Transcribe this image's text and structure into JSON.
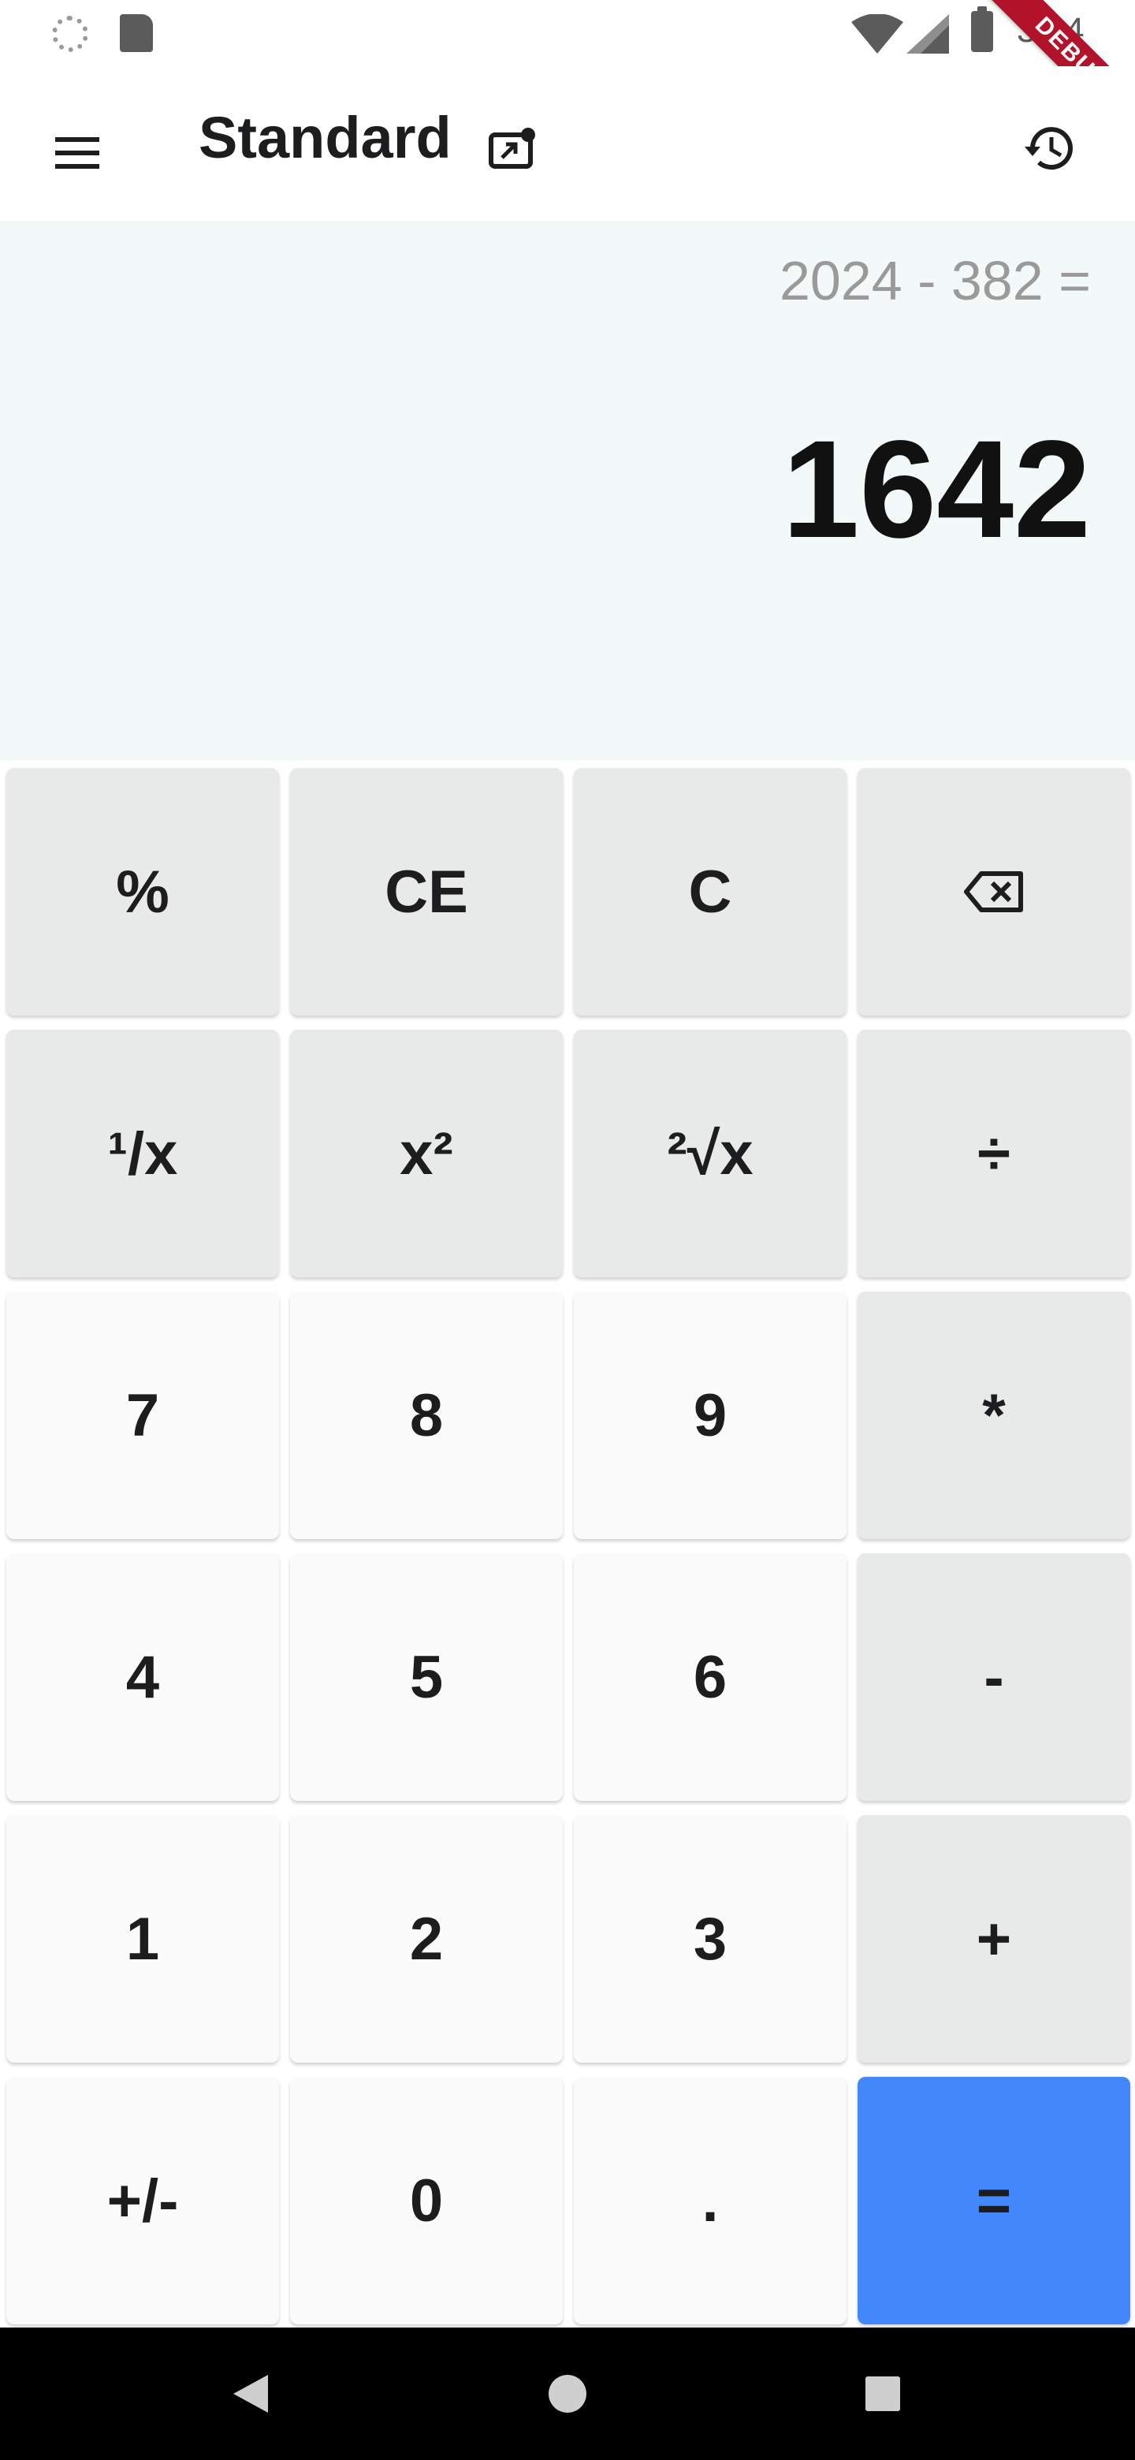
{
  "status_bar": {
    "time": "3:14",
    "icons": [
      "sync-icon",
      "sd-card-icon",
      "wifi-icon",
      "signal-icon",
      "battery-icon"
    ]
  },
  "debug_banner": "DEBUG",
  "app_bar": {
    "title": "Standard",
    "icons": {
      "menu": "menu-icon",
      "mode": "picture-in-picture-icon",
      "history": "history-icon"
    }
  },
  "display": {
    "expression": "2024 - 382 =",
    "result": "1642"
  },
  "keypad": {
    "rows": [
      [
        {
          "label": "%",
          "kind": "func"
        },
        {
          "label": "CE",
          "kind": "func"
        },
        {
          "label": "C",
          "kind": "func"
        },
        {
          "label": "",
          "kind": "func",
          "icon": "backspace-icon"
        }
      ],
      [
        {
          "label": "¹/x",
          "kind": "func"
        },
        {
          "label": "x²",
          "kind": "func"
        },
        {
          "label": "²√x",
          "kind": "func"
        },
        {
          "label": "÷",
          "kind": "op"
        }
      ],
      [
        {
          "label": "7",
          "kind": "num"
        },
        {
          "label": "8",
          "kind": "num"
        },
        {
          "label": "9",
          "kind": "num"
        },
        {
          "label": "*",
          "kind": "op"
        }
      ],
      [
        {
          "label": "4",
          "kind": "num"
        },
        {
          "label": "5",
          "kind": "num"
        },
        {
          "label": "6",
          "kind": "num"
        },
        {
          "label": "-",
          "kind": "op"
        }
      ],
      [
        {
          "label": "1",
          "kind": "num"
        },
        {
          "label": "2",
          "kind": "num"
        },
        {
          "label": "3",
          "kind": "num"
        },
        {
          "label": "+",
          "kind": "op"
        }
      ],
      [
        {
          "label": "+/-",
          "kind": "num"
        },
        {
          "label": "0",
          "kind": "num"
        },
        {
          "label": ".",
          "kind": "num"
        },
        {
          "label": "=",
          "kind": "eq"
        }
      ]
    ]
  },
  "colors": {
    "display_background": "#f3f8f8",
    "function_key": "#e8eaea",
    "number_key": "#fbfbfb",
    "equals_key": "#4388fb",
    "expression_text": "#9a9a9a",
    "debug_ribbon": "#b2132b"
  },
  "nav_bar": {
    "icons": [
      "back-icon",
      "home-icon",
      "recents-icon"
    ]
  }
}
